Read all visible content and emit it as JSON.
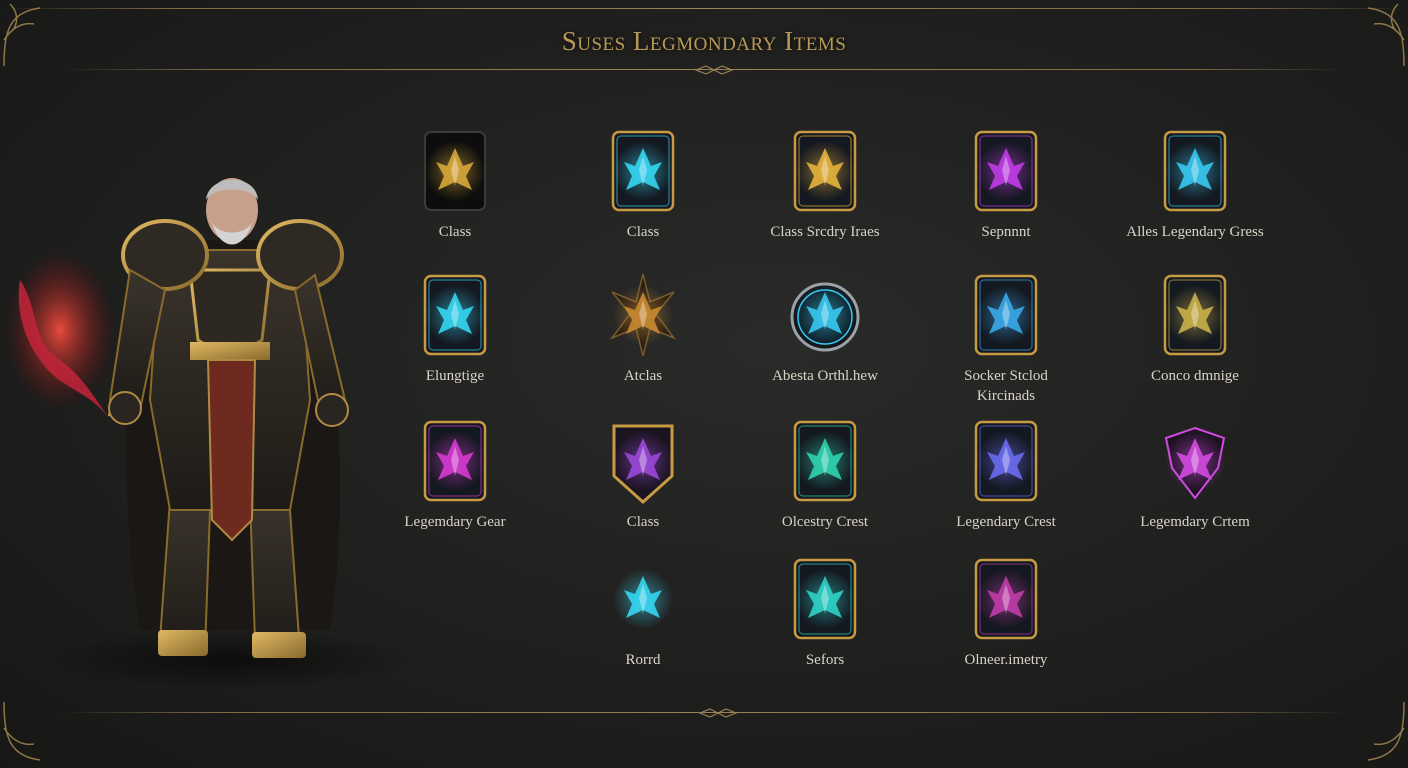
{
  "title": "Suses Legmondary Items",
  "colors": {
    "gold": "#b89856",
    "cyan": "#35d6f2",
    "purple": "#b43ce6",
    "magenta": "#d53ad0",
    "teal": "#2fd3b0",
    "red": "#c2243a",
    "label": "#d9d4c7"
  },
  "hero": {
    "icon": "armored-warrior-portrait"
  },
  "items": [
    {
      "label": "Class",
      "icon": "gold-gauntlet-icon",
      "accent": "#d8a83a",
      "frame": "dark-card"
    },
    {
      "label": "Class",
      "icon": "cyan-blade-icon",
      "accent": "#35d6f2",
      "frame": "card"
    },
    {
      "label": "Class Srcdry Iraes",
      "icon": "gold-demon-mask-icon",
      "accent": "#e6b23c",
      "frame": "card"
    },
    {
      "label": "Sepnnnt",
      "icon": "purple-claw-icon",
      "accent": "#c03ce6",
      "frame": "card"
    },
    {
      "label": "Alles Legendary Gress",
      "icon": "cyan-spirit-icon",
      "accent": "#38c8f0",
      "frame": "card"
    },
    {
      "label": "Elungtige",
      "icon": "cyan-crystal-icon",
      "accent": "#35d6f2",
      "frame": "card"
    },
    {
      "label": "Atclas",
      "icon": "gold-spikes-icon",
      "accent": "#c98a32",
      "frame": "burst"
    },
    {
      "label": "Abesta Orthl.hew",
      "icon": "cyan-swirl-shield-icon",
      "accent": "#38c8f0",
      "frame": "round"
    },
    {
      "label": "Socker Stclod\nKircinads",
      "icon": "cyan-dragon-icon",
      "accent": "#3aa8e8",
      "frame": "card"
    },
    {
      "label": "Conco dmnige",
      "icon": "gold-helm-icon",
      "accent": "#c9b048",
      "frame": "card"
    },
    {
      "label": "Legemdary Gear",
      "icon": "magenta-star-icon",
      "accent": "#d53ad0",
      "frame": "card"
    },
    {
      "label": "Class",
      "icon": "purple-skull-shield-icon",
      "accent": "#9a48d8",
      "frame": "shield"
    },
    {
      "label": "Olcestry Crest",
      "icon": "teal-mask-icon",
      "accent": "#2fd3b0",
      "frame": "card"
    },
    {
      "label": "Legendary Crest",
      "icon": "blue-spiked-crest-icon",
      "accent": "#6a6cf0",
      "frame": "card"
    },
    {
      "label": "Legemdary Crtem",
      "icon": "magenta-demon-icon",
      "accent": "#d14ae0",
      "frame": "wings"
    },
    {
      "label": "Rorrd",
      "icon": "cyan-star-icon",
      "accent": "#35d6f2",
      "frame": "star"
    },
    {
      "label": "Sefors",
      "icon": "teal-hood-icon",
      "accent": "#2fd3c8",
      "frame": "card"
    },
    {
      "label": "Olneer.imetry",
      "icon": "magenta-serpent-icon",
      "accent": "#c03ca8",
      "frame": "card"
    }
  ]
}
